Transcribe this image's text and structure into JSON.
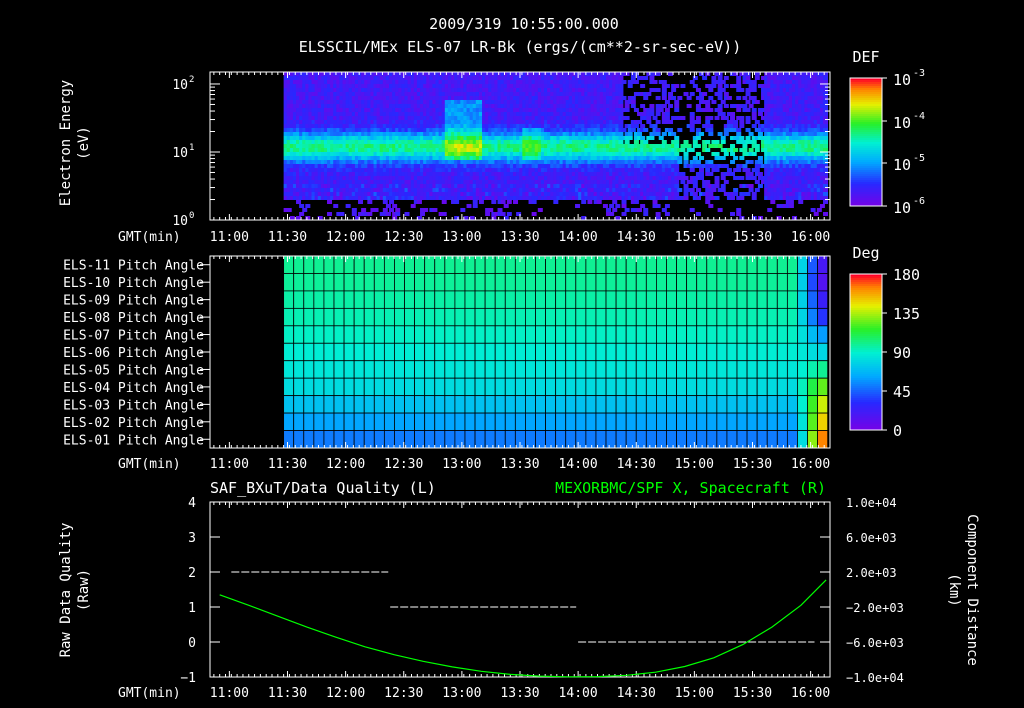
{
  "header": {
    "line1": "2009/319 10:55:00.000",
    "line2": "ELSSCIL/MEx ELS-07 LR-Bk  (ergs/(cm**2-sr-sec-eV))"
  },
  "chart_data": [
    {
      "type": "heatmap",
      "name": "electron-spectrogram",
      "ylabel": "Electron Energy",
      "yunit": "(eV)",
      "yscale": "log",
      "ylim": [
        1,
        150
      ],
      "yticks": [
        {
          "value": 1,
          "mantissa": "10",
          "exp": "0"
        },
        {
          "value": 10,
          "mantissa": "10",
          "exp": "1"
        },
        {
          "value": 100,
          "mantissa": "10",
          "exp": "2"
        }
      ],
      "xlabel": "GMT(min)",
      "x_range_min": [
        650,
        970
      ],
      "x_ticks": [
        "11:00",
        "11:30",
        "12:00",
        "12:30",
        "13:00",
        "13:30",
        "14:00",
        "14:30",
        "15:00",
        "15:30",
        "16:00"
      ],
      "x_tick_values": [
        660,
        690,
        720,
        750,
        780,
        810,
        840,
        870,
        900,
        930,
        960
      ],
      "data_start_min": 688,
      "colorbar": {
        "title": "DEF",
        "scale": "log",
        "labels": [
          {
            "mantissa": "10",
            "exp": "-3"
          },
          {
            "mantissa": "10",
            "exp": "-4"
          },
          {
            "mantissa": "10",
            "exp": "-5"
          },
          {
            "mantissa": "10",
            "exp": "-6"
          }
        ]
      }
    },
    {
      "type": "heatmap",
      "name": "pitch-angle",
      "rows": [
        "ELS-11 Pitch Angle",
        "ELS-10 Pitch Angle",
        "ELS-09 Pitch Angle",
        "ELS-08 Pitch Angle",
        "ELS-07 Pitch Angle",
        "ELS-06 Pitch Angle",
        "ELS-05 Pitch Angle",
        "ELS-04 Pitch Angle",
        "ELS-03 Pitch Angle",
        "ELS-02 Pitch Angle",
        "ELS-01 Pitch Angle"
      ],
      "row_pitch_deg_start": [
        100,
        99,
        97,
        95,
        92,
        89,
        86,
        82,
        72,
        62,
        52
      ],
      "row_pitch_deg_end": [
        20,
        15,
        25,
        35,
        60,
        80,
        100,
        125,
        140,
        150,
        165
      ],
      "transition_start_min": 950,
      "data_start_min": 688,
      "data_end_min": 965,
      "xlabel": "GMT(min)",
      "x_ticks": [
        "11:00",
        "11:30",
        "12:00",
        "12:30",
        "13:00",
        "13:30",
        "14:00",
        "14:30",
        "15:00",
        "15:30",
        "16:00"
      ],
      "colorbar": {
        "title": "Deg",
        "labels": [
          "180",
          "135",
          "90",
          "45",
          "0"
        ],
        "range": [
          0,
          180
        ]
      }
    },
    {
      "type": "line",
      "name": "data-quality-and-position",
      "left_title": "SAF_BXuT/Data Quality (L)",
      "right_title": "MEXORBMC/SPF X, Spacecraft (R)",
      "ylabel_left": "Raw Data Quality",
      "ylabel_left_unit": "(Raw)",
      "ylim_left": [
        -1,
        4
      ],
      "yticks_left": [
        "4",
        "3",
        "2",
        "1",
        "0",
        "−1"
      ],
      "ylabel_right": "Component Distance",
      "ylabel_right_unit": "(km)",
      "ylim_right": [
        -10000,
        10000
      ],
      "yticks_right": [
        "1.0e+04",
        "6.0e+03",
        "2.0e+03",
        "−2.0e+03",
        "−6.0e+03",
        "−1.0e+04"
      ],
      "xlabel": "GMT(min)",
      "x_ticks": [
        "11:00",
        "11:30",
        "12:00",
        "12:30",
        "13:00",
        "13:30",
        "14:00",
        "14:30",
        "15:00",
        "15:30",
        "16:00"
      ],
      "series": [
        {
          "name": "SAF_BXuT/Data Quality",
          "axis": "left",
          "color": "#ffffff",
          "style": "dashed",
          "segments": [
            {
              "x": [
                661,
                742
              ],
              "y": 2
            },
            {
              "x": [
                743,
                839
              ],
              "y": 1
            },
            {
              "x": [
                840,
                962
              ],
              "y": 0
            }
          ]
        },
        {
          "name": "MEXORBMC/SPF X, Spacecraft",
          "axis": "right",
          "color": "#00ff00",
          "style": "solid",
          "x": [
            655,
            670,
            685,
            700,
            715,
            730,
            745,
            760,
            775,
            790,
            805,
            820,
            835,
            850,
            865,
            880,
            895,
            910,
            925,
            940,
            955,
            968
          ],
          "y": [
            -600,
            -1800,
            -3050,
            -4300,
            -5450,
            -6550,
            -7450,
            -8200,
            -8850,
            -9350,
            -9700,
            -9900,
            -9980,
            -9950,
            -9800,
            -9450,
            -8800,
            -7800,
            -6300,
            -4300,
            -1800,
            1100
          ]
        }
      ]
    }
  ]
}
